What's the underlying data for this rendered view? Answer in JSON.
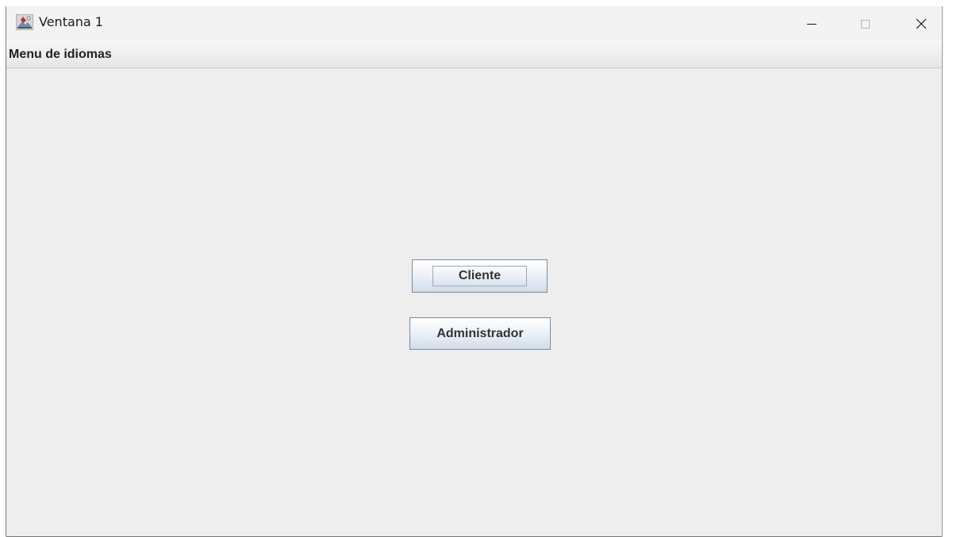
{
  "window": {
    "title": "Ventana 1"
  },
  "menubar": {
    "items": [
      {
        "label": "Menu de idiomas"
      }
    ]
  },
  "main": {
    "buttons": [
      {
        "label": "Cliente",
        "focused": true
      },
      {
        "label": "Administrador",
        "focused": false
      }
    ]
  },
  "icons": {
    "app": "java-cup-icon",
    "minimize": "minimize-icon",
    "maximize": "maximize-icon",
    "close": "close-icon"
  },
  "colors": {
    "window_bg": "#eeeeee",
    "titlebar_bg": "#f3f3f3",
    "button_border": "#7a8a99",
    "button_text": "#333333"
  }
}
